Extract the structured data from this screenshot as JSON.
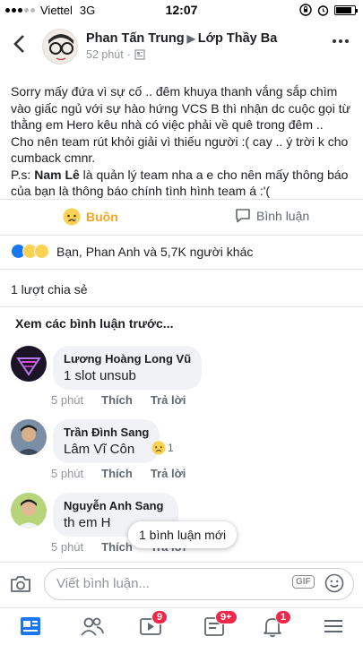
{
  "status_bar": {
    "carrier": "Viettel",
    "network": "3G",
    "time": "12:07"
  },
  "post": {
    "author": "Phan Tấn Trung",
    "group": "Lớp Thầy Ba",
    "time": "52 phút",
    "text_lines": [
      "Sorry mấy đứa vì sự cố .. đêm khuya thanh vắng sắp chìm",
      "vào giấc ngủ với sự hào hứng VCS B thì nhận dc cuộc gọi từ",
      "thằng em Hero kêu nhà có việc phải về quê trong đêm ..",
      "Cho nên team rút khỏi giải vì thiếu người :( cay .. ý trời k cho",
      "cumback cmnr."
    ],
    "ps_prefix": "P.s: ",
    "ps_mention": "Nam Lê",
    "ps_rest": " là quản lý team nha a e cho nên mấy thông báo",
    "ps_line2": "của bạn là thông báo chính tình hình team á :'("
  },
  "actions": {
    "reaction_label": "Buồn",
    "comment_label": "Bình luận"
  },
  "summary": {
    "text": "Bạn, Phan Anh và 5,7K người khác",
    "shares": "1 lượt chia sẻ",
    "prev_comments": "Xem các bình luận trước..."
  },
  "comments": [
    {
      "author": "Lương Hoàng Long Vũ",
      "text": "1 slot unsub",
      "time": "5 phút",
      "like": "Thích",
      "reply": "Trả lời"
    },
    {
      "author": "Trần Đình Sang",
      "text": "Lâm Vĩ Côn",
      "time": "5 phút",
      "like": "Thích",
      "reply": "Trả lời",
      "reaction_count": "1"
    },
    {
      "author": "Nguyễn Anh Sang",
      "text": "th em H",
      "time": "5 phút",
      "like": "Thích",
      "reply": "Trả lời"
    }
  ],
  "toast": "1 bình luận mới",
  "composer": {
    "placeholder": "Viết bình luận...",
    "gif": "GIF"
  },
  "tabbar": {
    "badges": {
      "watch": "9",
      "pages": "9+",
      "notifications": "1"
    }
  },
  "colors": {
    "brand": "#1877f2",
    "sad": "#f5a623",
    "badge": "#f02849"
  }
}
